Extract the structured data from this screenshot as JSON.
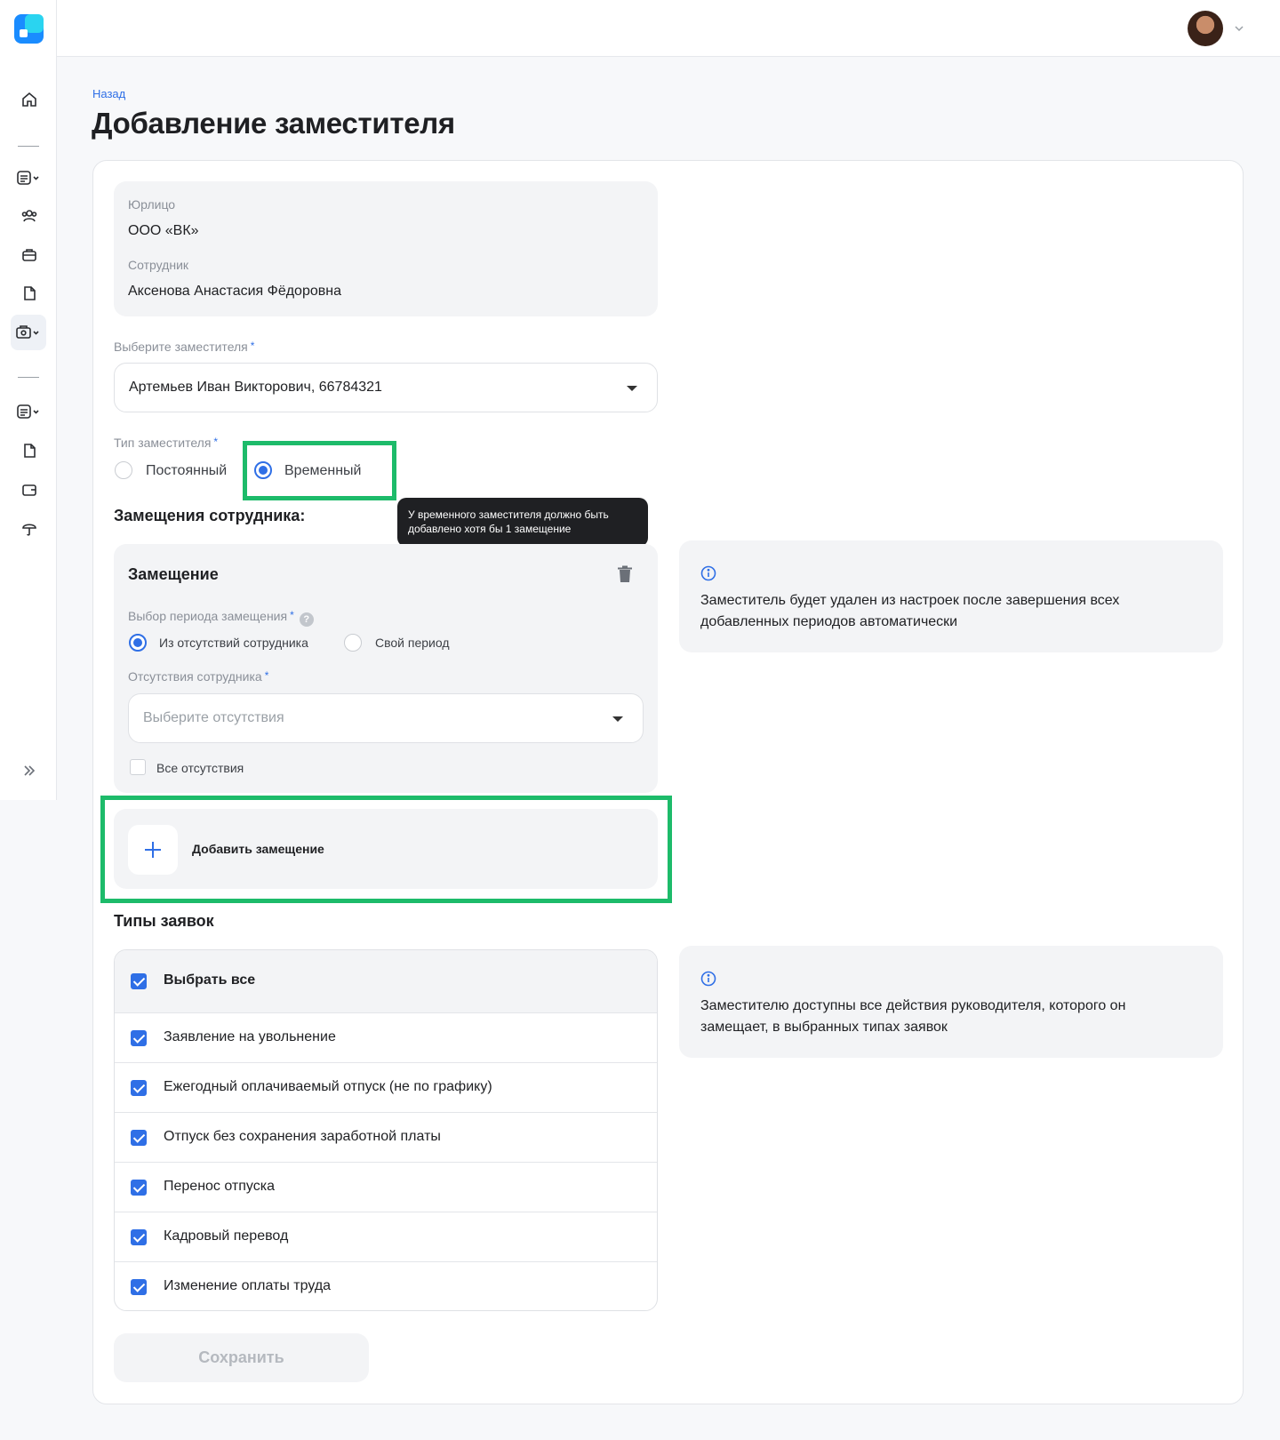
{
  "nav": {
    "back": "Назад"
  },
  "page": {
    "title": "Добавление заместителя"
  },
  "info": {
    "legal_label": "Юрлицо",
    "legal_value": "ООО «ВК»",
    "employee_label": "Сотрудник",
    "employee_value": "Аксенова Анастасия Фёдоровна"
  },
  "deputy": {
    "label": "Выберите заместителя",
    "required": "*",
    "value": "Артемьев Иван Викторович, 66784321"
  },
  "deputy_type": {
    "label": "Тип заместителя",
    "required": "*",
    "options": [
      "Постоянный",
      "Временный"
    ],
    "selected": "Временный"
  },
  "substitutions": {
    "title": "Замещения сотрудника:",
    "tooltip": "У временного заместителя должно быть добавлено хотя бы 1 замещение",
    "item_title": "Замещение",
    "period_label": "Выбор периода замещения",
    "period_help": "?",
    "period_options": [
      "Из отсутствий сотрудника",
      "Свой период"
    ],
    "absences_label": "Отсутствия сотрудника",
    "absences_placeholder": "Выберите отсутствия",
    "all_absences": "Все отсутствия",
    "add_label": "Добавить замещение"
  },
  "notes": {
    "substitution": "Заместитель будет удален из настроек после завершения всех добавленных периодов автоматически",
    "types": "Заместителю доступны все действия руководителя, которого он замещает, в выбранных типах заявок"
  },
  "request_types": {
    "title": "Типы заявок",
    "select_all": "Выбрать все",
    "items": [
      "Заявление на увольнение",
      "Ежегодный оплачиваемый отпуск (не по графику)",
      "Отпуск без сохранения заработной платы",
      "Перенос отпуска",
      "Кадровый перевод",
      "Изменение оплаты труда"
    ]
  },
  "actions": {
    "save": "Сохранить"
  },
  "colors": {
    "accent": "#2f6fe6",
    "highlight": "#1dbb6a"
  }
}
